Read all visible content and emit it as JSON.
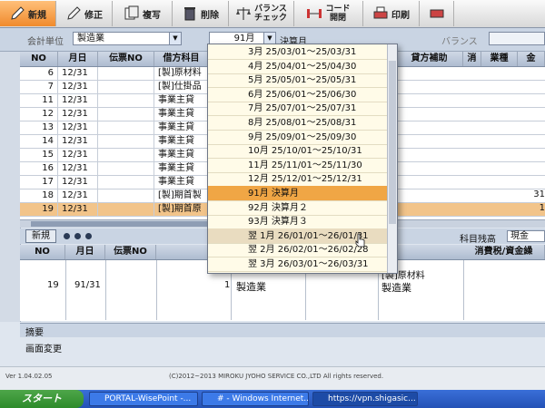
{
  "toolbar": {
    "new": "新規",
    "edit": "修正",
    "copy": "複写",
    "delete": "削除",
    "balance_check_1": "バランス",
    "balance_check_2": "チェック",
    "code_open_1": "コード",
    "code_open_2": "開閉",
    "print": "印刷"
  },
  "filter": {
    "unit_label": "会計単位",
    "unit_value": "製造業",
    "month_value": "91月",
    "month_label": "決算月",
    "balance_label": "バランス"
  },
  "grid1": {
    "headers": [
      "NO",
      "月日",
      "伝票NO",
      "借方科目",
      "貸方補助",
      "消",
      "業種",
      "金"
    ],
    "rows": [
      {
        "no": "6",
        "date": "12/31",
        "account": "[製]原材料"
      },
      {
        "no": "7",
        "date": "12/31",
        "account": "[製]仕掛品"
      },
      {
        "no": "11",
        "date": "12/31",
        "account": "事業主貸"
      },
      {
        "no": "12",
        "date": "12/31",
        "account": "事業主貸"
      },
      {
        "no": "13",
        "date": "12/31",
        "account": "事業主貸"
      },
      {
        "no": "14",
        "date": "12/31",
        "account": "事業主貸"
      },
      {
        "no": "15",
        "date": "12/31",
        "account": "事業主貸"
      },
      {
        "no": "16",
        "date": "12/31",
        "account": "事業主貸"
      },
      {
        "no": "17",
        "date": "12/31",
        "account": "事業主貸"
      },
      {
        "no": "18",
        "date": "12/31",
        "account": "[製]期首製"
      },
      {
        "no": "19",
        "date": "12/31",
        "account": "[製]期首原"
      }
    ],
    "right_values": [
      "31",
      "1"
    ]
  },
  "section2": {
    "new_tab": "新規",
    "headers": [
      "NO",
      "月日",
      "伝票NO",
      "消費税/資金繰"
    ],
    "remain_label": "科目残高",
    "remain_value": "現金",
    "row": {
      "no": "19",
      "date": "91/31",
      "num": "1",
      "sector": "製造業",
      "account_1": "[製]原材料",
      "account_2": "製造業"
    }
  },
  "bottom": {
    "summary": "摘要",
    "screen_change": "画面変更"
  },
  "footer": {
    "version": "Ver 1.04.02.05",
    "copyright": "(C)2012~2013 MIROKU JYOHO SERVICE CO.,LTD All rights reserved."
  },
  "dropdown": {
    "items": [
      "3月 25/03/01～25/03/31",
      "4月 25/04/01～25/04/30",
      "5月 25/05/01～25/05/31",
      "6月 25/06/01～25/06/30",
      "7月 25/07/01～25/07/31",
      "8月 25/08/01～25/08/31",
      "9月 25/09/01～25/09/30",
      "10月 25/10/01～25/10/31",
      "11月 25/11/01～25/11/30",
      "12月 25/12/01～25/12/31",
      "91月 決算月",
      "92月 決算月２",
      "93月 決算月３",
      "翌 1月 26/01/01～26/01/31",
      "翌 2月 26/02/01～26/02/28",
      "翌 3月 26/03/01～26/03/31"
    ],
    "selected_index": 10,
    "hover_index": 13
  },
  "taskbar": {
    "start": "スタート",
    "tasks": [
      "PORTAL-WisePoint -...",
      "# - Windows Internet...",
      "https://vpn.shigasic..."
    ]
  },
  "colors": {
    "accent": "#f08a2c",
    "selection": "#f0a645",
    "header": "#aebcd0"
  }
}
